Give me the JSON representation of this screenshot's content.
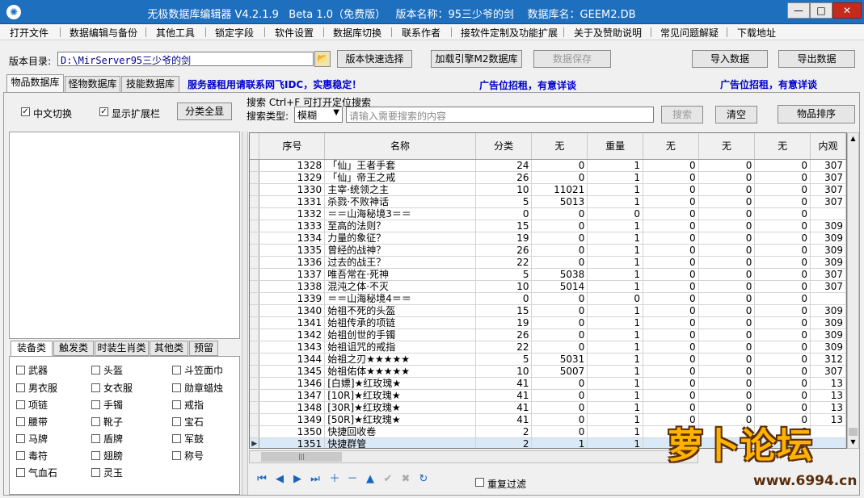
{
  "window": {
    "title": "无极数据库编辑器 V4.2.1.9   Beta 1.0（免费版）   版本名称：95三少爷的剑    数据库名：GEEM2.DB",
    "app_icon": "dragon-icon"
  },
  "menu": [
    "打开文件",
    "数据编辑与备份",
    "其他工具",
    "锁定字段",
    "软件设置",
    "数据库切换",
    "联系作者",
    "接软件定制及功能扩展",
    "关于及赞助说明",
    "常见问题解疑",
    "下载地址"
  ],
  "toolbar": {
    "dir_label": "版本目录:",
    "dir_value": "D:\\MirServer95三少爷的剑",
    "quick_select": "版本快速选择",
    "load_engine": "加载引擎M2数据库",
    "save_data": "数据保存",
    "import": "导入数据",
    "export": "导出数据"
  },
  "tabs": [
    "物品数据库",
    "怪物数据库",
    "技能数据库"
  ],
  "ads": [
    "服务器租用请联系网飞IDC，实惠稳定！",
    "广告位招租，有意详谈",
    "广告位招租，有意详谈"
  ],
  "options": {
    "chinese_switch": "中文切换",
    "show_extend": "显示扩展栏",
    "show_all": "分类全显",
    "search_hint": "搜索  Ctrl+F 可打开定位搜索",
    "search_type_label": "搜索类型:",
    "search_type_value": "模糊",
    "search_placeholder": "请输入需要搜索的内容",
    "search_btn": "搜索",
    "clear_btn": "清空",
    "sort_btn": "物品排序"
  },
  "category_tabs": [
    "装备类",
    "触发类",
    "时装生肖类",
    "其他类",
    "预留"
  ],
  "categories": [
    "武器",
    "头盔",
    "斗笠面巾",
    "男衣服",
    "女衣服",
    "勋章蜡烛",
    "项链",
    "手镯",
    "戒指",
    "腰带",
    "靴子",
    "宝石",
    "马牌",
    "盾牌",
    "军鼓",
    "毒符",
    "翅膀",
    "称号",
    "气血石",
    "灵玉"
  ],
  "grid": {
    "columns": [
      "序号",
      "名称",
      "分类",
      "无",
      "重量",
      "无",
      "无",
      "无",
      "内观"
    ],
    "rows": [
      [
        "1328",
        "「仙」王者手套",
        "24",
        "0",
        "1",
        "0",
        "0",
        "0",
        "307"
      ],
      [
        "1329",
        "「仙」帝王之戒",
        "26",
        "0",
        "1",
        "0",
        "0",
        "0",
        "307"
      ],
      [
        "1330",
        "主宰·统领之主",
        "10",
        "11021",
        "1",
        "0",
        "0",
        "0",
        "307"
      ],
      [
        "1331",
        "杀戮·不败神话",
        "5",
        "5013",
        "1",
        "0",
        "0",
        "0",
        "307"
      ],
      [
        "1332",
        "＝＝山海秘境3＝＝",
        "0",
        "0",
        "0",
        "0",
        "0",
        "0",
        ""
      ],
      [
        "1333",
        "至高的法则？",
        "15",
        "0",
        "1",
        "0",
        "0",
        "0",
        "309"
      ],
      [
        "1334",
        "力量的象征？",
        "19",
        "0",
        "1",
        "0",
        "0",
        "0",
        "309"
      ],
      [
        "1335",
        "曾经的战神？",
        "26",
        "0",
        "1",
        "0",
        "0",
        "0",
        "309"
      ],
      [
        "1336",
        "过去的战王？",
        "22",
        "0",
        "1",
        "0",
        "0",
        "0",
        "309"
      ],
      [
        "1337",
        "唯吾常在·死神",
        "5",
        "5038",
        "1",
        "0",
        "0",
        "0",
        "307"
      ],
      [
        "1338",
        "混沌之体·不灭",
        "10",
        "5014",
        "1",
        "0",
        "0",
        "0",
        "307"
      ],
      [
        "1339",
        "＝＝山海秘境4＝＝",
        "0",
        "0",
        "0",
        "0",
        "0",
        "0",
        ""
      ],
      [
        "1340",
        "始祖不死的头盔",
        "15",
        "0",
        "1",
        "0",
        "0",
        "0",
        "309"
      ],
      [
        "1341",
        "始祖传承的项链",
        "19",
        "0",
        "1",
        "0",
        "0",
        "0",
        "309"
      ],
      [
        "1342",
        "始祖创世的手镯",
        "26",
        "0",
        "1",
        "0",
        "0",
        "0",
        "309"
      ],
      [
        "1343",
        "始祖诅咒的戒指",
        "22",
        "0",
        "1",
        "0",
        "0",
        "0",
        "309"
      ],
      [
        "1344",
        "始祖之刃★★★★★",
        "5",
        "5031",
        "1",
        "0",
        "0",
        "0",
        "312"
      ],
      [
        "1345",
        "始祖佑体★★★★★",
        "10",
        "5007",
        "1",
        "0",
        "0",
        "0",
        "307"
      ],
      [
        "1346",
        "[白嫖]★红玫瑰★",
        "41",
        "0",
        "1",
        "0",
        "0",
        "0",
        "13"
      ],
      [
        "1347",
        "[10R]★红玫瑰★",
        "41",
        "0",
        "1",
        "0",
        "0",
        "0",
        "13"
      ],
      [
        "1348",
        "[30R]★红玫瑰★",
        "41",
        "0",
        "1",
        "0",
        "0",
        "0",
        "13"
      ],
      [
        "1349",
        "[50R]★红玫瑰★",
        "41",
        "0",
        "1",
        "0",
        "0",
        "0",
        "13"
      ],
      [
        "1350",
        "快捷回收卷",
        "2",
        "0",
        "1",
        "0",
        "0",
        "0",
        ""
      ],
      [
        "1351",
        "快捷群管",
        "2",
        "1",
        "1",
        "",
        "",
        "",
        ""
      ]
    ],
    "selected_row": 23
  },
  "footer": {
    "nav_icons": [
      "first-icon",
      "prior-icon",
      "next-icon",
      "last-icon",
      "insert-icon",
      "delete-icon",
      "edit-icon",
      "post-icon",
      "cancel-icon",
      "refresh-icon"
    ],
    "repeat_filter": "重复过滤"
  },
  "watermark": {
    "title": "萝卜论坛",
    "url": "www.6994.cn"
  }
}
